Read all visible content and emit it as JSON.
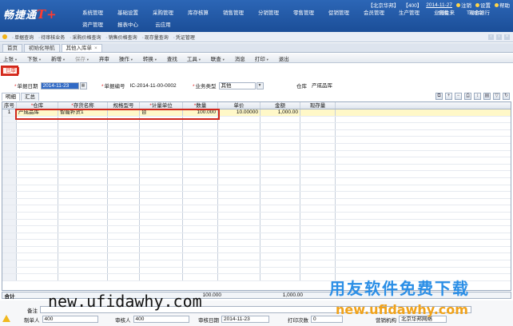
{
  "app": {
    "logo_text": "畅捷通",
    "logo_suffix": "T+"
  },
  "top_info": {
    "company": "【北京华邦】",
    "code": "【400】",
    "date": "2014-11-27",
    "logout": "注销",
    "settings": "设置",
    "help": "帮助"
  },
  "nav": {
    "row1": [
      "系统管理",
      "基础设置",
      "采购管理",
      "库存核算",
      "销售管理",
      "分销管理",
      "零售管理",
      "促销管理",
      "会员管理",
      "生产管理",
      "业务往来",
      "现金银行",
      "切换",
      "T-UFO"
    ],
    "row2": [
      "资产管理",
      "报表中心",
      "云应用"
    ]
  },
  "quick_tabs": [
    "单据查询",
    "待审核业务",
    "采购价格查询",
    "销售价格查询",
    "现存量查询",
    "凭证管理"
  ],
  "page_tabs": [
    {
      "label": "首页"
    },
    {
      "label": "初始化导航"
    },
    {
      "label": "其他入库单",
      "active": true
    }
  ],
  "toolbar": {
    "items": [
      {
        "label": "上张",
        "arrow": true
      },
      {
        "label": "下张",
        "arrow": true
      },
      {
        "label": "新增",
        "arrow": true
      },
      {
        "label": "保存",
        "arrow": true,
        "disabled": true
      },
      {
        "label": "弃审"
      },
      {
        "label": "操作",
        "arrow": true
      },
      {
        "label": "转换",
        "arrow": true
      },
      {
        "label": "查找"
      },
      {
        "label": "工具",
        "arrow": true
      },
      {
        "label": "联查",
        "arrow": true
      },
      {
        "label": "消息"
      },
      {
        "label": "打印",
        "arrow": true
      },
      {
        "label": "退出"
      }
    ]
  },
  "status_badge": "已审",
  "form": {
    "date_label": "单据日期",
    "date_value": "2014-11-23",
    "code_label": "单据编号",
    "code_value": "IC-2014-11-00-0002",
    "type_label": "业务类型",
    "type_value": "其他",
    "warehouse_label": "仓库",
    "warehouse_value": "产成品库"
  },
  "detail_tabs": [
    "明细",
    "汇总"
  ],
  "grid": {
    "columns": [
      "序号",
      "仓库",
      "存货名称",
      "规格型号",
      "计量单位",
      "数量",
      "单价",
      "金额",
      "现存量"
    ],
    "rows": [
      {
        "no": "1",
        "warehouse": "产成品库",
        "name": "智能补货1",
        "spec": "",
        "unit": "台",
        "qty": "100.000",
        "price": "10.00000",
        "amount": "1,000.00",
        "stock": ""
      }
    ],
    "empty_rows": 24
  },
  "summary": {
    "label": "合计",
    "qty": "100.000",
    "amount": "1,000.00"
  },
  "footer": {
    "remark_label": "备注",
    "maker_label": "制单人",
    "maker_value": "400",
    "approver_label": "审核人",
    "approver_value": "400",
    "approve_date_label": "审核日期",
    "approve_date_value": "2014-11-23",
    "print_label": "打印次数",
    "print_value": "0",
    "org_label": "营销机构",
    "org_value": "北京华邦网络"
  },
  "watermarks": {
    "url_black": "new.ufidawhy.com",
    "brand_blue": "用友软件免费下载",
    "url_orange": "new.ufidawhy.com"
  }
}
